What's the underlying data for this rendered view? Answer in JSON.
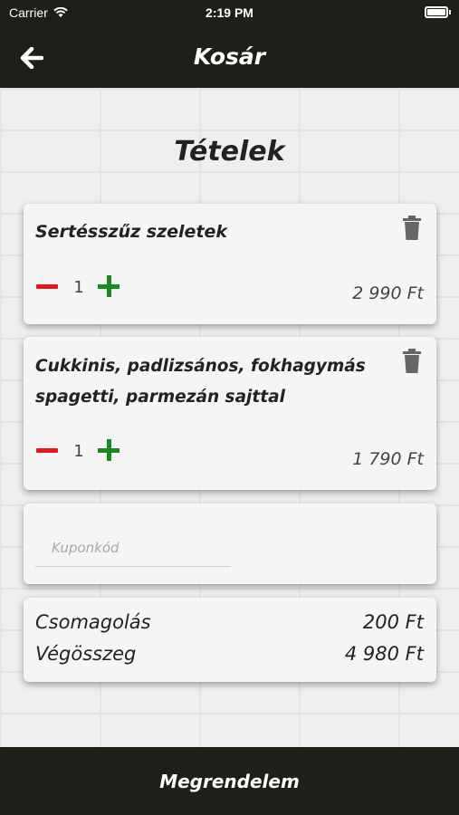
{
  "status_bar": {
    "carrier": "Carrier",
    "time": "2:19 PM",
    "battery_level": 1.0
  },
  "nav": {
    "title": "Kosár",
    "back_icon": "arrow-left-icon"
  },
  "section_title": "Tételek",
  "items": [
    {
      "name": "Sertésszűz szeletek",
      "quantity": "1",
      "price": "2 990 Ft"
    },
    {
      "name": "Cukkinis, padlizsános, fokhagymás spagetti, parmezán sajttal",
      "quantity": "1",
      "price": "1 790 Ft"
    }
  ],
  "coupon": {
    "value": "",
    "placeholder": "Kuponkód"
  },
  "summary": {
    "packaging_label": "Csomagolás",
    "packaging_value": "200 Ft",
    "total_label": "Végösszeg",
    "total_value": "4 980 Ft"
  },
  "order_button": {
    "label": "Megrendelem"
  },
  "colors": {
    "bar": "#1f1f1a",
    "minus": "#e8151b",
    "plus": "#1a8a22"
  }
}
